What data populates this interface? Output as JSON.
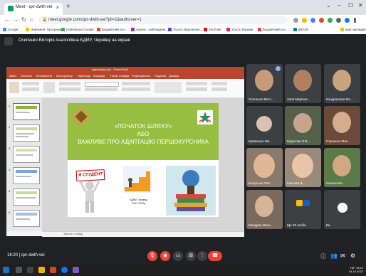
{
  "browser": {
    "tab_title": "Meet - qxr-dwth-vei",
    "tab_close": "×",
    "new_tab": "+",
    "window_controls": [
      "⌄",
      "–",
      "☐",
      "✕"
    ],
    "url": "meet.google.com/qxr-dwth-vei?pli=1&authuser=1",
    "bookmarks": [
      "Google",
      "Навчання: Програмна",
      "Навчальна Google",
      "Бюджетний роз...",
      "Аналіз - наблюдени...",
      "Усього браузером...",
      "YouTube",
      "Усього Музика",
      "Бюджетний роз...",
      "вВУЗИ"
    ],
    "bookmarks_right": "Інші закладки"
  },
  "meet": {
    "presenter_text": "Осипенко Вікторія Анатоліївна БДМУ, Чернівці на екрані",
    "clock": "16:20",
    "meeting_code": "qxr-dwth-vei",
    "participants": [
      {
        "name": "Осипенко Вікто...",
        "color": "#6b4a3a"
      },
      {
        "name": "Зоря Маріяна...",
        "color": "#7a5c48"
      },
      {
        "name": "Кондрашова Ма...",
        "color": "#8a6e54"
      },
      {
        "name": "Кривченко Ма...",
        "color": "#5b6470"
      },
      {
        "name": "Бідючова О.В...",
        "color": "#6d7c5a"
      },
      {
        "name": "Глушенко Мак...",
        "color": "#8a5a40"
      },
      {
        "name": "Білоусько Світ...",
        "color": "#b09070"
      },
      {
        "name": "Ігнатова Д...",
        "color": "#a07a60"
      },
      {
        "name": "Ігнатюк Ме...",
        "color": "#6a8a5a"
      },
      {
        "name": "Мандрик-Мель...",
        "color": "#9a7a66"
      },
      {
        "name": "Ще 33 особи",
        "color": "#3c4043"
      },
      {
        "name": "Ви",
        "color": "#4a4a4a"
      }
    ]
  },
  "presentation": {
    "window_title": "адаптація.pptx - PowerPoint",
    "ribbon_tabs": [
      "Файл",
      "Основне",
      "Вставлення",
      "Конструктор",
      "Переходи",
      "Анімація",
      "Показ слайдів",
      "Рецензування",
      "Подання",
      "Довідка"
    ],
    "slide_numbers": [
      "1",
      "2",
      "3",
      "4",
      "5",
      "6"
    ],
    "notes_hint": "Замітки к слайду",
    "slide": {
      "line1": "«ПОЧАТОК ШЛЯХУ»",
      "line2": "АБО",
      "line3": "ВАЖЛИВЕ ПРО АДАПТАЦІЮ ПЕРШОКУРСНИКА",
      "sign": "Я СТУДЕНТ",
      "caption1": "БДМУ, Чернівці,",
      "caption2": "04.10.2022р."
    }
  },
  "taskbar": {
    "time": "16:20",
    "date": "04.10.2022",
    "lang": "УКР"
  },
  "colors": {
    "meet_bg": "#202124",
    "slide_green": "#97be41",
    "ppt_red": "#b7472a",
    "end_call": "#ea4335"
  }
}
